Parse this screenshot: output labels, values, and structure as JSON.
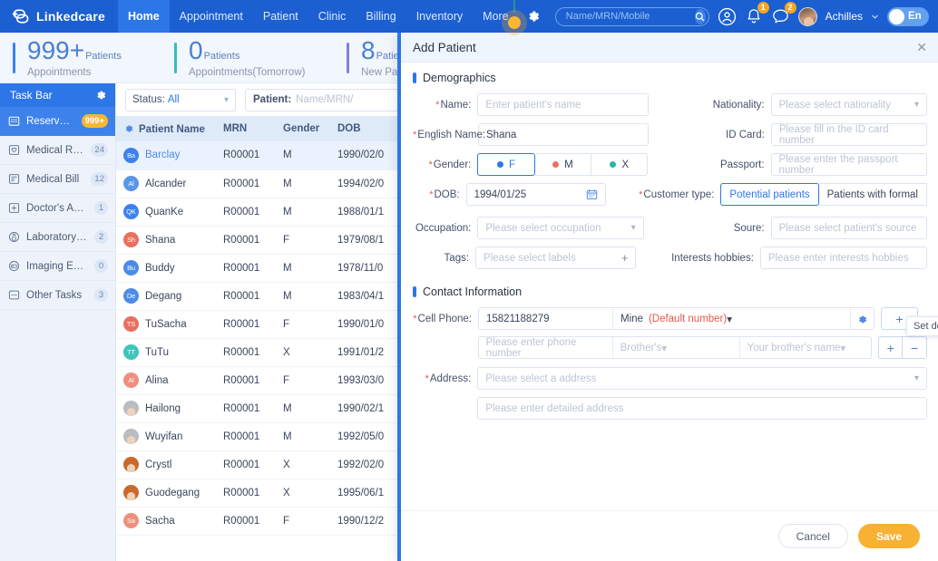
{
  "nav": {
    "brand": "Linkedcare",
    "items": [
      {
        "label": "Home",
        "active": true
      },
      {
        "label": "Appointment",
        "active": false
      },
      {
        "label": "Patient",
        "active": false
      },
      {
        "label": "Clinic",
        "active": false
      },
      {
        "label": "Billing",
        "active": false
      },
      {
        "label": "Inventory",
        "active": false
      },
      {
        "label": "More",
        "active": false
      }
    ],
    "gear_icon": "gear-icon",
    "search_placeholder": "Name/MRN/Mobile",
    "search_value": "",
    "account_icon": "user-circle-icon",
    "bell_icon": "bell-icon",
    "bell_badge": "1",
    "chat_icon": "chat-icon",
    "chat_badge": "2",
    "user_name": "Achilles",
    "lang_label": "En"
  },
  "stats": [
    {
      "number": "999+",
      "unit": "Patients",
      "sub": "Appointments",
      "color": "#2d76e8"
    },
    {
      "number": "0",
      "unit": "Patients",
      "sub": "Appointments(Tomorrow)",
      "color": "#35c0b7"
    },
    {
      "number": "8",
      "unit": "Patients",
      "sub": "New Patients",
      "color": "#8a7bd8"
    }
  ],
  "sidebar": {
    "title": "Task Bar",
    "gear_icon": "gear-icon",
    "items": [
      {
        "label": "Reservation",
        "count": "999+",
        "active": true,
        "icon": "calendar-icon"
      },
      {
        "label": "Medical Record",
        "count": "24",
        "active": false,
        "icon": "record-icon"
      },
      {
        "label": "Medical Bill",
        "count": "12",
        "active": false,
        "icon": "bill-icon"
      },
      {
        "label": "Doctor's Advice",
        "count": "1",
        "active": false,
        "icon": "advice-icon"
      },
      {
        "label": "Laboratory Ex...",
        "count": "2",
        "active": false,
        "icon": "lab-icon"
      },
      {
        "label": "Imaging Exam...",
        "count": "0",
        "active": false,
        "icon": "imaging-icon"
      },
      {
        "label": "Other Tasks",
        "count": "3",
        "active": false,
        "icon": "other-icon"
      }
    ]
  },
  "list": {
    "status_label": "Status:",
    "status_value": "All",
    "patient_label": "Patient:",
    "patient_placeholder": "Name/MRN/",
    "columns": [
      "Patient Name",
      "MRN",
      "Gender",
      "DOB"
    ],
    "rows": [
      {
        "initials": "Ba",
        "name": "Barclay",
        "mrn": "R00001",
        "gender": "M",
        "dob": "1990/02/0",
        "color": "#3d82ea",
        "photo": false,
        "selected": true
      },
      {
        "initials": "Al",
        "name": "Alcander",
        "mrn": "R00001",
        "gender": "M",
        "dob": "1994/02/0",
        "color": "#5a96e8",
        "photo": false,
        "selected": false
      },
      {
        "initials": "QK",
        "name": "QuanKe",
        "mrn": "R00001",
        "gender": "M",
        "dob": "1988/01/1",
        "color": "#3d82ea",
        "photo": false,
        "selected": false
      },
      {
        "initials": "Sh",
        "name": "Shana",
        "mrn": "R00001",
        "gender": "F",
        "dob": "1979/08/1",
        "color": "#e8705f",
        "photo": false,
        "selected": false
      },
      {
        "initials": "Bu",
        "name": "Buddy",
        "mrn": "R00001",
        "gender": "M",
        "dob": "1978/11/0",
        "color": "#4a8ce6",
        "photo": false,
        "selected": false
      },
      {
        "initials": "De",
        "name": "Degang",
        "mrn": "R00001",
        "gender": "M",
        "dob": "1983/04/1",
        "color": "#4a8ce6",
        "photo": false,
        "selected": false
      },
      {
        "initials": "TS",
        "name": "TuSacha",
        "mrn": "R00001",
        "gender": "F",
        "dob": "1990/01/0",
        "color": "#e8705f",
        "photo": false,
        "selected": false
      },
      {
        "initials": "TT",
        "name": "TuTu",
        "mrn": "R00001",
        "gender": "X",
        "dob": "1991/01/2",
        "color": "#3ec4bb",
        "photo": false,
        "selected": false
      },
      {
        "initials": "Al",
        "name": "Alina",
        "mrn": "R00001",
        "gender": "F",
        "dob": "1993/03/0",
        "color": "#ef8f7e",
        "photo": false,
        "selected": false
      },
      {
        "initials": "",
        "name": "Hailong",
        "mrn": "R00001",
        "gender": "M",
        "dob": "1990/02/1",
        "color": "#b9bcc2",
        "photo": true,
        "selected": false
      },
      {
        "initials": "",
        "name": "Wuyifan",
        "mrn": "R00001",
        "gender": "M",
        "dob": "1992/05/0",
        "color": "#b9bcc2",
        "photo": true,
        "selected": false
      },
      {
        "initials": "",
        "name": "Crystl",
        "mrn": "R00001",
        "gender": "X",
        "dob": "1992/02/0",
        "color": "#c96a2a",
        "photo": true,
        "selected": false
      },
      {
        "initials": "",
        "name": "Guodegang",
        "mrn": "R00001",
        "gender": "X",
        "dob": "1995/06/1",
        "color": "#c96a2a",
        "photo": true,
        "selected": false
      },
      {
        "initials": "Sa",
        "name": "Sacha",
        "mrn": "R00001",
        "gender": "F",
        "dob": "1990/12/2",
        "color": "#ef8f7e",
        "photo": false,
        "selected": false
      }
    ]
  },
  "panel": {
    "title": "Add Patient",
    "close_icon": "close-icon",
    "demographics": {
      "heading": "Demographics",
      "name_label": "Name:",
      "name_value": "",
      "name_placeholder": "Enter patient's name",
      "english_name_label": "English Name:",
      "english_name_value": "Shana",
      "gender_label": "Gender:",
      "gender_options": [
        {
          "label": "F",
          "color": "#2d76e8",
          "selected": true
        },
        {
          "label": "M",
          "color": "#e8705f",
          "selected": false
        },
        {
          "label": "X",
          "color": "#2bb3a7",
          "selected": false
        }
      ],
      "dob_label": "DOB:",
      "dob_value": "1994/01/25",
      "calendar_icon": "calendar-icon",
      "occupation_label": "Occupation:",
      "occupation_placeholder": "Please select occupation",
      "tags_label": "Tags:",
      "tags_placeholder": "Please select labels",
      "tags_add_icon": "plus-icon",
      "nationality_label": "Nationality:",
      "nationality_placeholder": "Please select nationality",
      "id_card_label": "ID Card:",
      "id_card_placeholder": "Please fill in the ID card number",
      "passport_label": "Passport:",
      "passport_placeholder": "Please enter the passport number",
      "customer_type_label": "Customer type:",
      "customer_type_options": [
        {
          "label": "Potential patients",
          "selected": true
        },
        {
          "label": "Patients with formal",
          "selected": false
        }
      ],
      "source_label": "Soure:",
      "source_placeholder": "Please select patient's source",
      "hobbies_label": "Interests hobbies:",
      "hobbies_placeholder": "Please enter interests hobbies"
    },
    "contact": {
      "heading": "Contact Information",
      "cell_phone_label": "Cell Phone:",
      "primary_phone_value": "15821188279",
      "primary_relation": "Mine",
      "primary_default_tag": "(Default number)",
      "gear_icon": "gear-icon",
      "add_icon": "plus-icon",
      "secondary_phone_placeholder": "Please enter phone number",
      "secondary_relation_placeholder": "Brother's",
      "secondary_name_placeholder": "Your brother's name",
      "row_add_icon": "plus-icon",
      "row_remove_icon": "minus-icon",
      "tooltip": "Set default number",
      "address_label": "Address:",
      "address_placeholder": "Please select a address",
      "address_detail_placeholder": "Please enter detailed address"
    },
    "cancel_label": "Cancel",
    "save_label": "Save"
  }
}
